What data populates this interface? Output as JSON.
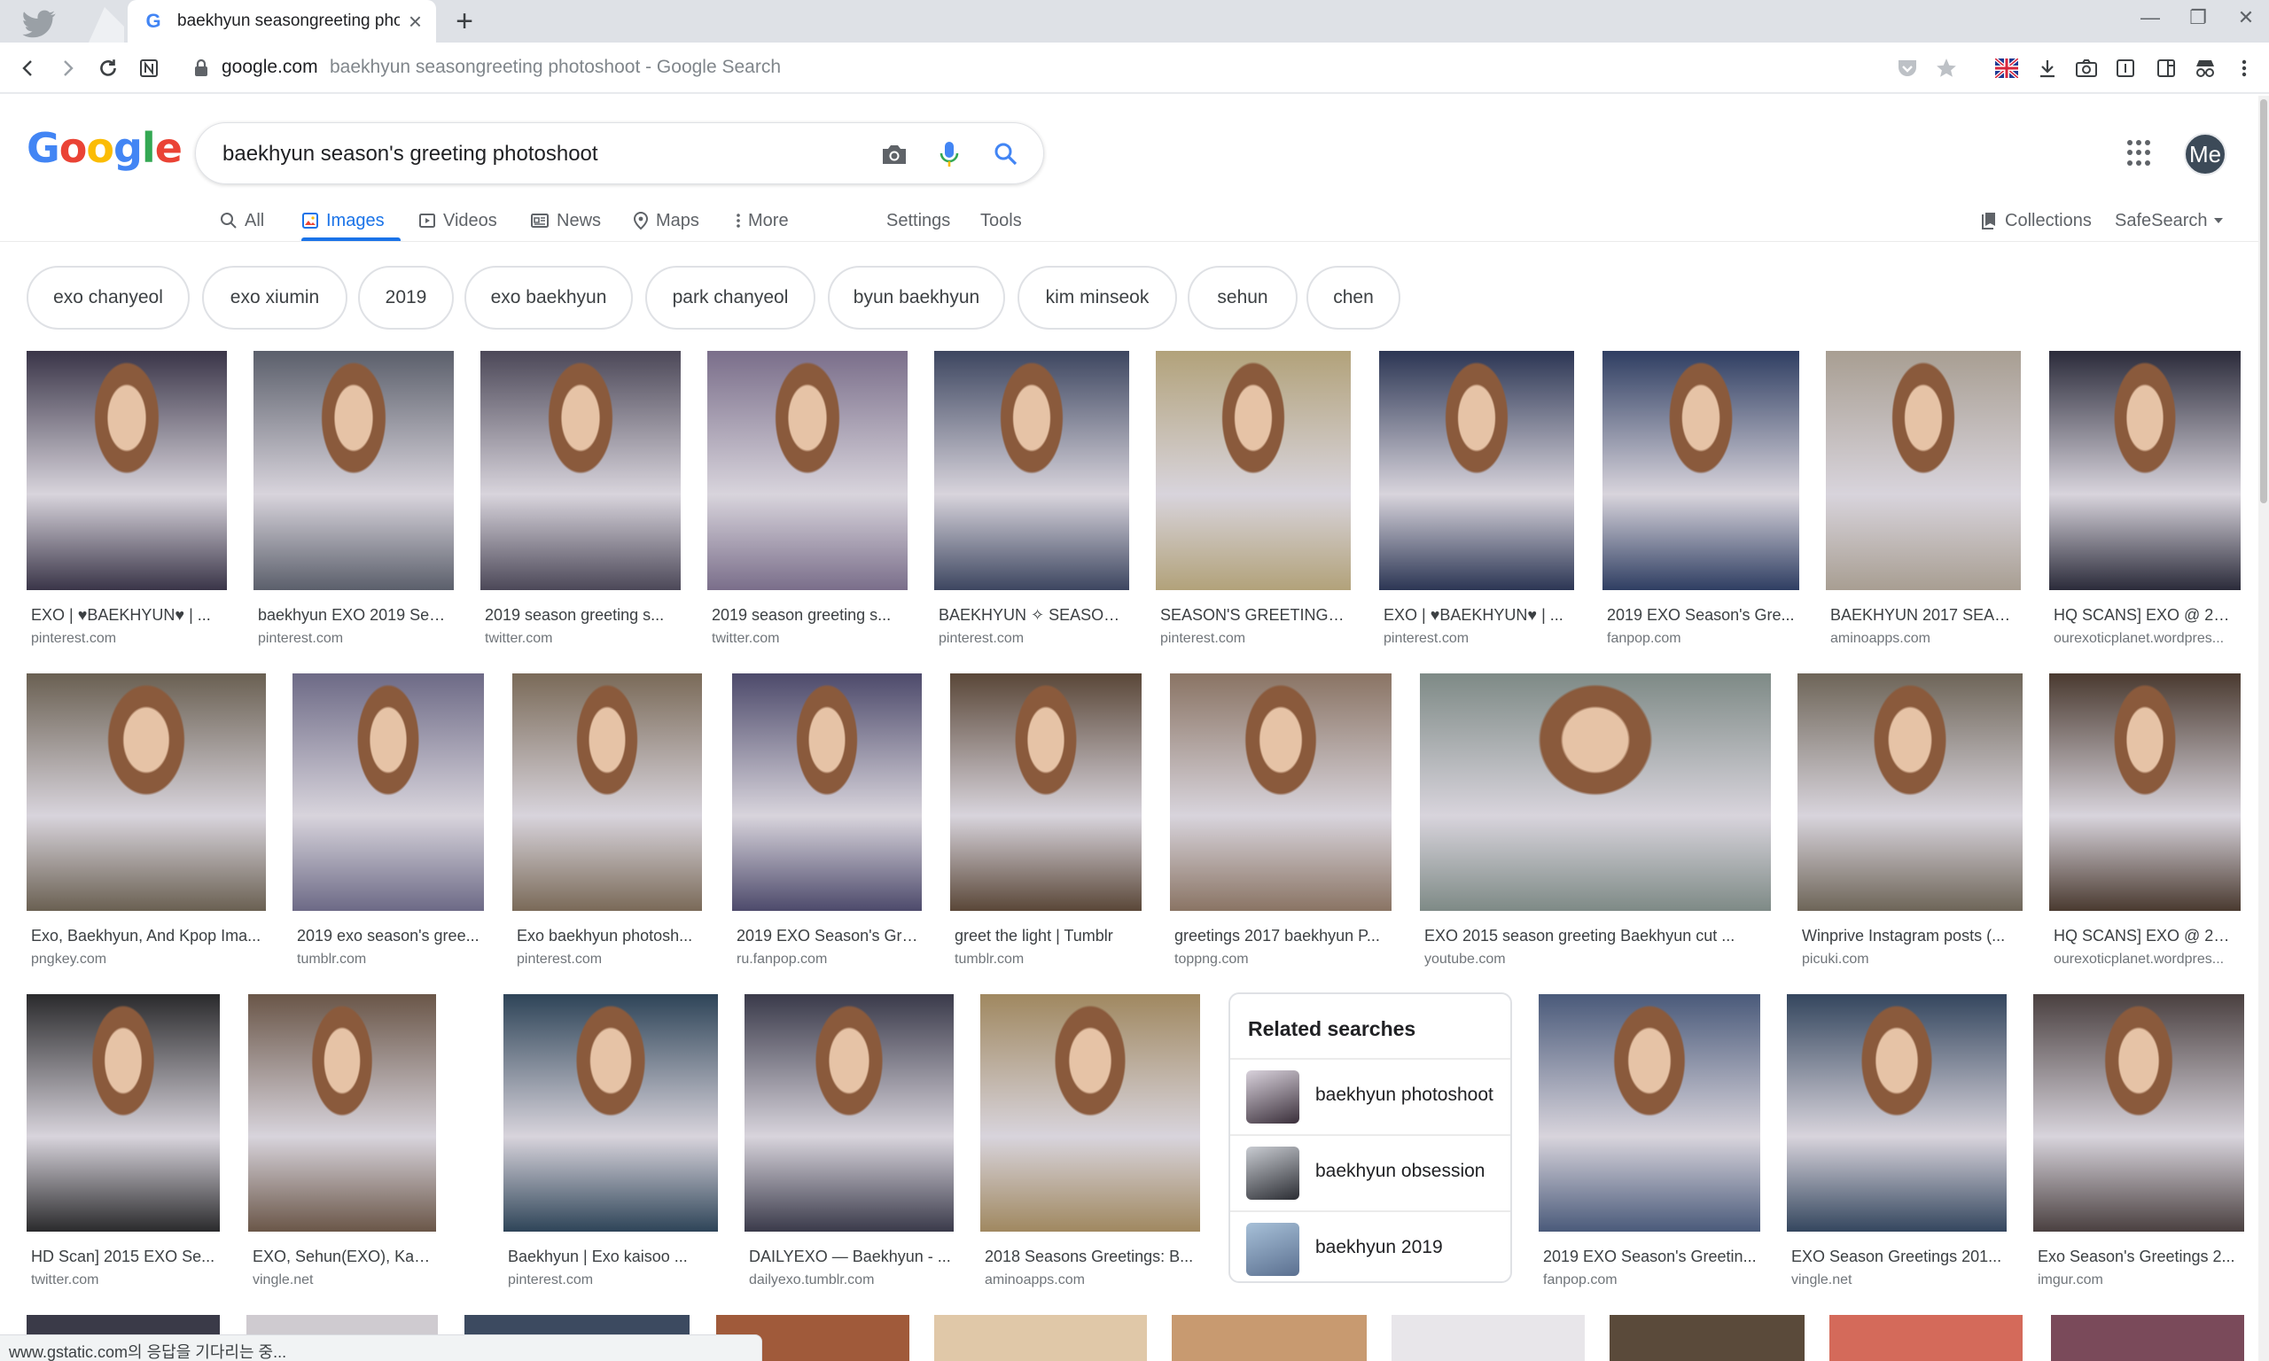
{
  "browser": {
    "tab_title": "baekhyun seasongreeting photoshoot - Google Search",
    "new_tab": "+",
    "url_domain": "google.com",
    "url_rest": "baekhyun seasongreeting photoshoot - Google Search",
    "status": "www.gstatic.com의 응답을 기다리는 중..."
  },
  "header": {
    "logo_letters": [
      "G",
      "o",
      "o",
      "g",
      "l",
      "e"
    ],
    "logo_colors": [
      "#4285f4",
      "#ea4335",
      "#fbbc05",
      "#4285f4",
      "#34a853",
      "#ea4335"
    ],
    "query": "baekhyun season's greeting photoshoot",
    "avatar": "Me"
  },
  "nav": {
    "all": "All",
    "images": "Images",
    "videos": "Videos",
    "news": "News",
    "maps": "Maps",
    "more": "More",
    "settings": "Settings",
    "tools": "Tools",
    "collections": "Collections",
    "safesearch": "SafeSearch"
  },
  "chips": [
    "exo chanyeol",
    "exo xiumin",
    "2019",
    "exo baekhyun",
    "park chanyeol",
    "byun baekhyun",
    "kim minseok",
    "sehun",
    "chen"
  ],
  "rows": [
    [
      {
        "title": "EXO | ♥BAEKHYUN♥ | ...",
        "source": "pinterest.com",
        "color": "#3a3548"
      },
      {
        "title": "baekhyun EXO 2019 Sea...",
        "source": "pinterest.com",
        "color": "#5b5f6b"
      },
      {
        "title": "2019 season greeting s...",
        "source": "twitter.com",
        "color": "#4c4858"
      },
      {
        "title": "2019 season greeting s...",
        "source": "twitter.com",
        "color": "#7a6e8a"
      },
      {
        "title": "BAEKHYUN ✧ SEASON'...",
        "source": "pinterest.com",
        "color": "#3d4660"
      },
      {
        "title": "SEASON'S GREETINGS ...",
        "source": "pinterest.com",
        "color": "#b2a27a"
      },
      {
        "title": "EXO | ♥BAEKHYUN♥ | ...",
        "source": "pinterest.com",
        "color": "#2c3654"
      },
      {
        "title": "2019 EXO Season's Gre...",
        "source": "fanpop.com",
        "color": "#2f3e62"
      },
      {
        "title": "BAEKHYUN 2017 SEAS...",
        "source": "aminoapps.com",
        "color": "#a89e92"
      },
      {
        "title": "HQ SCANS] EXO @ 201...",
        "source": "ourexoticplanet.wordpres...",
        "color": "#2b2b3a"
      }
    ],
    [
      {
        "title": "Exo, Baekhyun, And Kpop Ima...",
        "source": "pngkey.com",
        "color": "#6a6052"
      },
      {
        "title": "2019 exo season's gree...",
        "source": "tumblr.com",
        "color": "#6d6a86"
      },
      {
        "title": "Exo baekhyun photosh...",
        "source": "pinterest.com",
        "color": "#7a6a58"
      },
      {
        "title": "2019 EXO Season's Gre...",
        "source": "ru.fanpop.com",
        "color": "#4d4a6b"
      },
      {
        "title": "greet the light | Tumblr",
        "source": "tumblr.com",
        "color": "#5a4738"
      },
      {
        "title": "greetings 2017 baekhyun P...",
        "source": "toppng.com",
        "color": "#8a7464"
      },
      {
        "title": "EXO 2015 season greeting Baekhyun cut ...",
        "source": "youtube.com",
        "color": "#7e8a86"
      },
      {
        "title": "Winprive Instagram posts (...",
        "source": "picuki.com",
        "color": "#6e6558"
      },
      {
        "title": "HQ SCANS] EXO @ 201...",
        "source": "ourexoticplanet.wordpres...",
        "color": "#4a3a30"
      }
    ],
    [
      {
        "title": "HD Scan] 2015 EXO Se...",
        "source": "twitter.com",
        "color": "#2a2a2c"
      },
      {
        "title": "EXO, Sehun(EXO), Kai ...",
        "source": "vingle.net",
        "color": "#6a5648"
      },
      {
        "title": "Baekhyun | Exo kaisoo ...",
        "source": "pinterest.com",
        "color": "#2e4458"
      },
      {
        "title": "DAILYEXO — Baekhyun - ...",
        "source": "dailyexo.tumblr.com",
        "color": "#3a3a4a"
      },
      {
        "title": "2018 Seasons Greetings: B...",
        "source": "aminoapps.com",
        "color": "#a08860"
      },
      {
        "title": "2019 EXO Season's Greetin...",
        "source": "fanpop.com",
        "color": "#4a5a7a"
      },
      {
        "title": "EXO Season Greetings 201...",
        "source": "vingle.net",
        "color": "#34465e"
      },
      {
        "title": "Exo Season's Greetings 2...",
        "source": "imgur.com",
        "color": "#4a4040"
      }
    ]
  ],
  "related": {
    "title": "Related searches",
    "items": [
      "baekhyun photoshoot",
      "baekhyun obsession",
      "baekhyun 2019"
    ]
  }
}
